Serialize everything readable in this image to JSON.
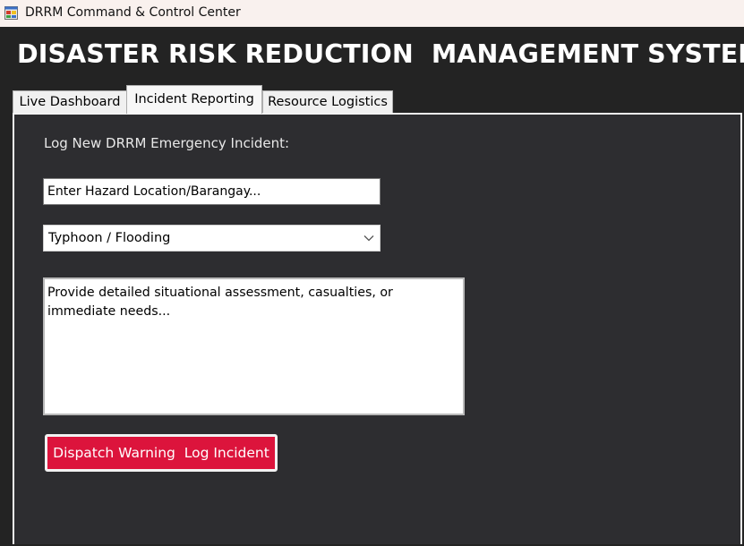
{
  "window": {
    "title": "DRRM Command & Control Center",
    "icon": "app-window-icon"
  },
  "header": {
    "title": "DISASTER RISK REDUCTION  MANAGEMENT SYSTEM"
  },
  "tabs": [
    {
      "label": "Live Dashboard",
      "active": false
    },
    {
      "label": "Incident Reporting",
      "active": true
    },
    {
      "label": "Resource Logistics",
      "active": false
    }
  ],
  "incident_form": {
    "section_label": "Log New DRRM Emergency Incident:",
    "location_placeholder": "Enter Hazard Location/Barangay...",
    "hazard_type_selected": "Typhoon / Flooding",
    "details_placeholder": "Provide detailed situational assessment, casualties, or immediate needs...",
    "dispatch_button_label": "Dispatch Warning  Log Incident"
  },
  "colors": {
    "background": "#232323",
    "panel": "#2d2d30",
    "accent_button": "#dc143c",
    "titlebar": "#f9f1ee"
  }
}
